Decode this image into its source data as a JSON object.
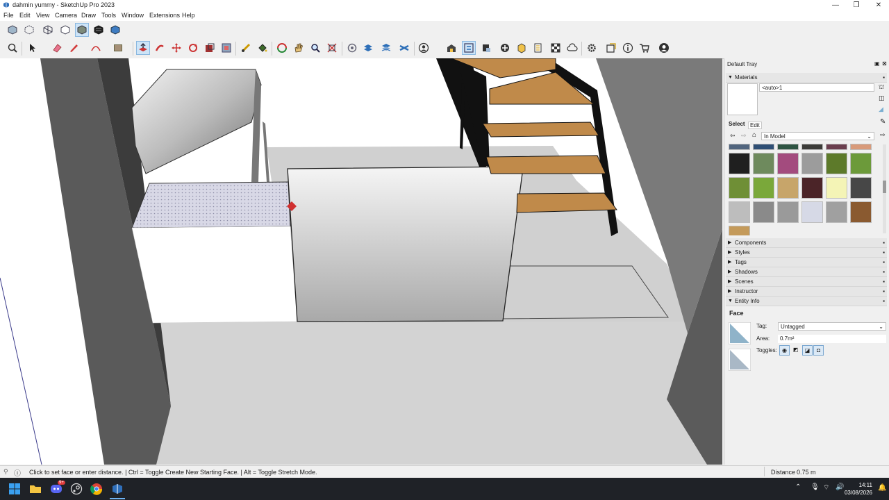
{
  "window": {
    "title": "dahmin yummy - SketchUp Pro 2023",
    "minimize": "—",
    "maximize": "❐",
    "close": "✕"
  },
  "menu": [
    "File",
    "Edit",
    "View",
    "Camera",
    "Draw",
    "Tools",
    "Window",
    "Extensions",
    "Help"
  ],
  "toolbar_top": [
    "xray-style",
    "backedges-style",
    "wireframe-style",
    "hiddenline-style",
    "shaded-style",
    "shaded-textures-style",
    "monochrome-style"
  ],
  "toolbar_main": [
    "zoom-extents",
    "select",
    "eraser",
    "pencil-line",
    "arc",
    "rectangle",
    "push-pull",
    "follow-me",
    "move",
    "rotate",
    "scale",
    "offset",
    "tape-measure",
    "paint-bucket",
    "orbit",
    "pan",
    "zoom",
    "zoom-window",
    "section-plane",
    "layer-manager",
    "user-profile",
    "extension-warehouse"
  ],
  "tray": {
    "title": "Default Tray",
    "materials": {
      "header": "Materials",
      "current_name": "<auto>1",
      "tab_select": "Select",
      "tab_edit": "Edit",
      "library": "In Model",
      "swatch_colors": [
        "#51657e",
        "#2f4f75",
        "#2e5442",
        "#3b3b38",
        "#6a3e4e",
        "#d89a7a",
        "#1f1f1f",
        "#6e8a5d",
        "#a34b7e",
        "#9c9c9c",
        "#5d7a2a",
        "#6c9a3a",
        "#6f8f36",
        "#7aa83a",
        "#c7a56a",
        "#4b2428",
        "#f4f4b6",
        "#474747",
        "#bdbdbd",
        "#8a8a8a",
        "#9a9a9a",
        "#d6d9e6",
        "#a0a0a0",
        "#8a5a30",
        "#c49a5a"
      ]
    },
    "sections": [
      "Components",
      "Styles",
      "Tags",
      "Shadows",
      "Scenes",
      "Instructor",
      "Entity Info"
    ],
    "entity": {
      "type": "Face",
      "tag_label": "Tag:",
      "tag_value": "Untagged",
      "area_label": "Area:",
      "area_value": "0.7m²",
      "toggles_label": "Toggles:"
    }
  },
  "status": {
    "hint": "Click to set face or enter distance. | Ctrl = Toggle Create New Starting Face. | Alt = Toggle Stretch Mode.",
    "measure_label": "Distance",
    "measure_value": "0.75 m"
  },
  "taskbar": {
    "time": "14:11",
    "date": "03/08/2026",
    "badge": "9+"
  },
  "colors": {
    "accent": "#0078d4",
    "selection": "#cde4f7",
    "stair_wood": "#c08a4a",
    "stair_frame": "#111111"
  }
}
